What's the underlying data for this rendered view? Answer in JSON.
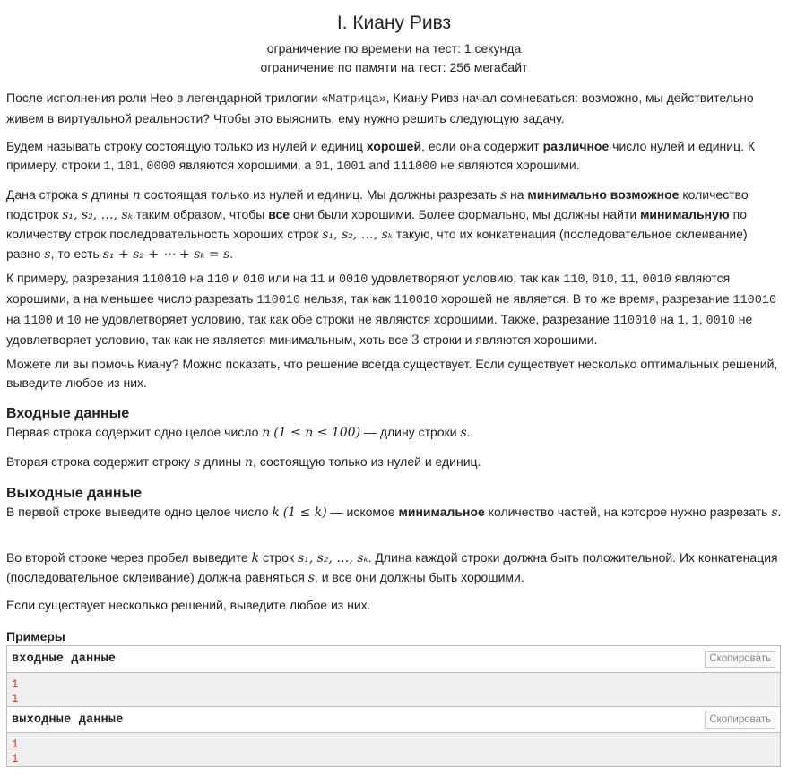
{
  "problem": {
    "title": "I. Киану Ривз",
    "time_limit": "ограничение по времени на тест: 1 секунда",
    "memory_limit": "ограничение по памяти на тест: 256 мегабайт"
  },
  "statement": {
    "p1_a": "После исполнения роли Нео в легендарной трилогии «",
    "p1_movie": "Матрица",
    "p1_b": "», Киану Ривз начал сомневаться: возможно, мы действительно живем в виртуальной реальности? Чтобы это выяснить, ему нужно решить следующую задачу.",
    "p2_a": "Будем называть строку состоящую только из нулей и единиц ",
    "p2_good": "хорошей",
    "p2_b": ", если она содержит ",
    "p2_diff": "различное",
    "p2_c": " число нулей и единиц. К примеру, строки ",
    "p2_ex1": "1",
    "p2_ex2": "101",
    "p2_ex3": "0000",
    "p2_d": " являются хорошими, а ",
    "p2_ex4": "01",
    "p2_ex5": "1001",
    "p2_and": " and ",
    "p2_ex6": "111000",
    "p2_e": " не являются хорошими.",
    "p3_a": "Дана строка ",
    "p3_b": " длины ",
    "p3_c": " состоящая только из нулей и единиц. Мы должны разрезать ",
    "p3_d": " на ",
    "p3_min": "минимально возможное",
    "p3_e": " количество подстрок ",
    "p3_f": " таким образом, чтобы ",
    "p3_all": "все",
    "p3_g": " они были хорошими. Более формально, мы должны найти ",
    "p3_min2": "минимальную",
    "p3_h": " по количеству строк последовательность хороших строк ",
    "p3_i": " такую, что их конкатенация (последовательное склеивание) равно ",
    "p3_j": ", то есть ",
    "p4_a": "К примеру, разрезания ",
    "p4_s": "110010",
    "p4_b": " на ",
    "p4_c1": "110",
    "p4_and": " и ",
    "p4_c2": "010",
    "p4_or": " или на ",
    "p4_c3": "11",
    "p4_c4": "0010",
    "p4_c": " удовлетворяют условию, так как ",
    "p4_d": " являются хорошими, а на меньшее число разрезать ",
    "p4_e": " нельзя, так как ",
    "p4_f": " хорошей не является. В то же время, разрезание ",
    "p4_c5": "1100",
    "p4_c6": "10",
    "p4_g": " не удовлетворяет условию, так как обе строки не являются хорошими. Также, разрезание ",
    "p4_c7": "1",
    "p4_h": " не удовлетворяет условию, так как не является минимальным, хоть все ",
    "p4_three": "3",
    "p4_i": " строки и являются хорошими.",
    "p5": "Можете ли вы помочь Киану? Можно показать, что решение всегда существует. Если существует несколько оптимальных решений, выведите любое из них."
  },
  "input_section": {
    "heading": "Входные данные",
    "p1_a": "Первая строка содержит одно целое число ",
    "p1_b": " — длину строки ",
    "p2_a": "Вторая строка содержит строку ",
    "p2_b": " длины ",
    "p2_c": ", состоящую только из нулей и единиц."
  },
  "output_section": {
    "heading": "Выходные данные",
    "p1_a": "В первой строке выведите одно целое число ",
    "p1_b": " — искомое ",
    "p1_min": "минимальное",
    "p1_c": " количество частей, на которое нужно разрезать ",
    "p2_a": "Во второй строке через пробел выведите ",
    "p2_b": " строк ",
    "p2_c": ". Длина каждой строки должна быть положительной. Их конкатенация (последовательное склеивание) должна равняться ",
    "p2_d": ", и все они должны быть хорошими.",
    "p3": "Если существует несколько решений, выведите любое из них."
  },
  "examples": {
    "heading": "Примеры",
    "input_label": "входные данные",
    "output_label": "выходные данные",
    "copy_label": "Скопировать",
    "input_lines": [
      "1",
      "1"
    ],
    "output_lines": [
      "1",
      "1"
    ]
  },
  "math": {
    "s": "s",
    "n": "n",
    "k": "k",
    "substrings": "s₁, s₂, …, sₖ",
    "concat_eq": "s₁ + s₂ + ⋯ + sₖ = s",
    "n_range": "(1 ≤ n ≤ 100)",
    "k_range": "(1 ≤ k)"
  }
}
